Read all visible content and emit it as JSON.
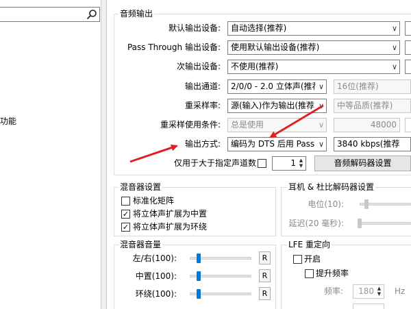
{
  "left": {
    "search_placeholder": "",
    "clipped_text": "功能"
  },
  "output": {
    "group_title": "音频输出",
    "rows": [
      {
        "label": "默认输出设备:",
        "value": "自动选择(推荐)"
      },
      {
        "label": "Pass Through 输出设备:",
        "value": "使用默认输出设备(推荐)"
      },
      {
        "label": "次输出设备:",
        "value": "不使用(推荐)"
      },
      {
        "label": "输出通道:",
        "value": "2/0/0 - 2.0 立体声(推荐)",
        "value2": "16位(推荐)"
      },
      {
        "label": "重采样率:",
        "value": "源(输入)作为输出(推荐)",
        "value2": "中等品质(推荐)"
      },
      {
        "label": "重采样使用条件:",
        "value": "总是使用",
        "value2": "48000"
      },
      {
        "label": "输出方式:",
        "value": "编码为 DTS 后用 Pass Through",
        "value2": "3840 kbps(推荐)"
      }
    ],
    "channels_label": "仅用于大于指定声道数",
    "channels_value": "1",
    "decoder_button": "音频解码器设置"
  },
  "mixer": {
    "group_title": "混音器设置",
    "items": [
      {
        "label": "标准化矩阵",
        "checked": false
      },
      {
        "label": "将立体声扩展为中置",
        "checked": true
      },
      {
        "label": "将立体声扩展为环绕",
        "checked": true
      }
    ]
  },
  "headphone": {
    "group_title": "耳机 & 杜比解码器设置",
    "level_label": "电位(10):",
    "delay_label": "延迟(20 毫秒):"
  },
  "volume": {
    "group_title": "混音器音量",
    "rows": [
      {
        "label": "左/右(100):",
        "reset": "R",
        "level": 0.14
      },
      {
        "label": "中置(100):",
        "reset": "R",
        "level": 0.14
      },
      {
        "label": "环绕(100):",
        "reset": "R",
        "level": 0.14
      }
    ]
  },
  "lfe": {
    "group_title": "LFE 重定向",
    "enable_label": "开启",
    "boost_label": "提升频率",
    "freq_label": "频率:",
    "freq_value": "180",
    "freq_unit": "Hz"
  },
  "colors": {
    "accent": "#0078d7",
    "arrow": "#e02020"
  }
}
